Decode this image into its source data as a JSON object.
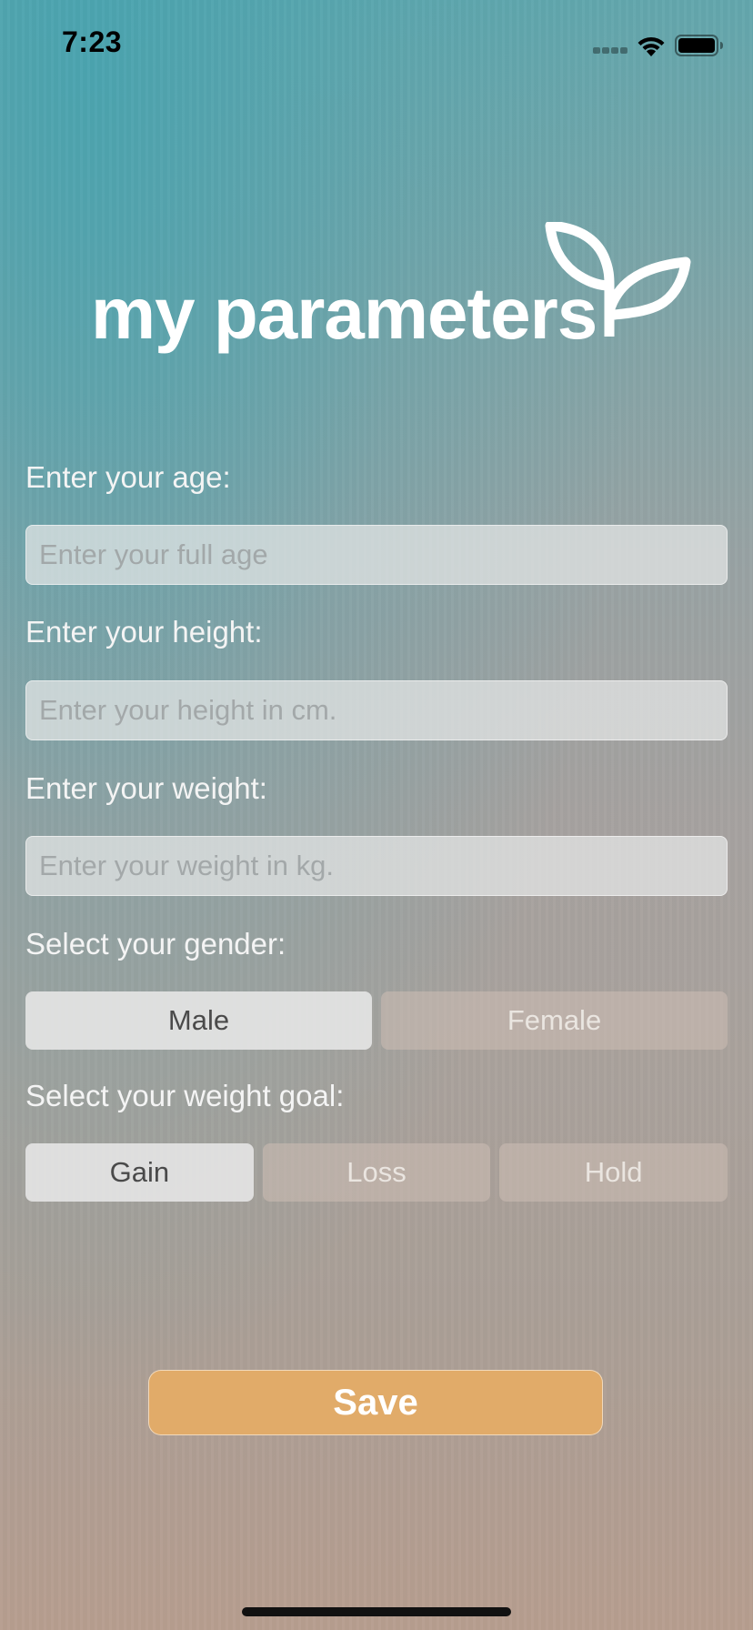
{
  "status_bar": {
    "time": "7:23"
  },
  "header": {
    "title": "my parameters",
    "logo_icon": "sprout-leaf-icon"
  },
  "form": {
    "age": {
      "label": "Enter your age:",
      "value": "",
      "placeholder": "Enter your full age"
    },
    "height": {
      "label": "Enter your height:",
      "value": "",
      "placeholder": "Enter your height in cm."
    },
    "weight": {
      "label": "Enter your weight:",
      "value": "",
      "placeholder": "Enter your weight in kg."
    },
    "gender": {
      "label": "Select your gender:",
      "options": [
        "Male",
        "Female"
      ],
      "selected": "Male"
    },
    "weight_goal": {
      "label": "Select your weight goal:",
      "options": [
        "Gain",
        "Loss",
        "Hold"
      ],
      "selected": "Gain"
    }
  },
  "actions": {
    "save_label": "Save"
  },
  "colors": {
    "accent": "#e1ab69",
    "selected_segment": "#e4e4e4",
    "title_text": "#ffffff"
  }
}
